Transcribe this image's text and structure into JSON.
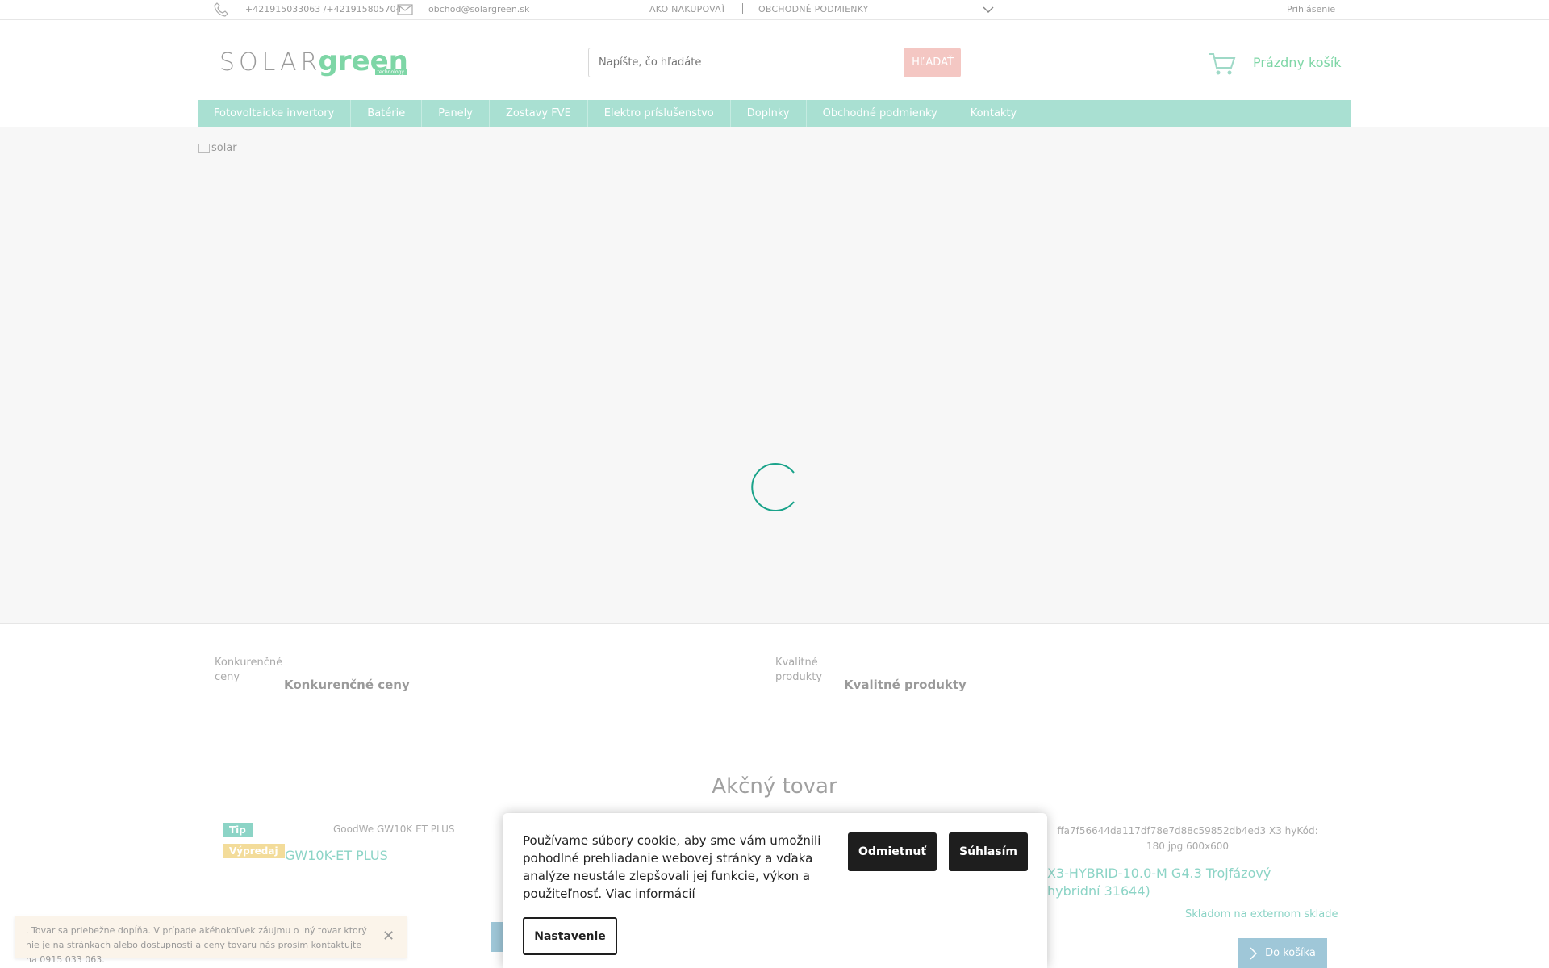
{
  "topbar": {
    "phone": "+421915033063 /+421915805704",
    "email": "obchod@solargreen.sk",
    "link_how_to_buy": "AKO NAKUPOVAŤ",
    "link_terms": "OBCHODNÉ PODMIENKY",
    "login": "Prihlásenie"
  },
  "header": {
    "logo_solar": "SOLAR",
    "logo_green": "green",
    "logo_sub": "technology",
    "search_placeholder": "Napíšte, čo hľadáte",
    "search_button": "HĽADAŤ",
    "cart_label": "Prázdny košík"
  },
  "nav": {
    "items": [
      {
        "label": "Fotovoltaicke invertory"
      },
      {
        "label": "Batérie"
      },
      {
        "label": "Panely"
      },
      {
        "label": "Zostavy FVE"
      },
      {
        "label": "Elektro príslušenstvo"
      },
      {
        "label": "Doplnky"
      },
      {
        "label": "Obchodné podmienky"
      },
      {
        "label": "Kontakty"
      }
    ]
  },
  "banner": {
    "image_alt": "solar"
  },
  "benefits": [
    {
      "image_alt": "Konkurenčné ceny",
      "label": "Konkurenčné ceny"
    },
    {
      "image_alt": "Kvalitné produkty",
      "label": "Kvalitné produkty"
    }
  ],
  "section_title": "Akčný tovar",
  "products": [
    {
      "badge_tip": "Tip",
      "badge_sale": "Výpredaj",
      "image_alt": "GoodWe GW10K ET PLUS",
      "name": "GW10K-ET PLUS"
    },
    {
      "image_alt": "ffa7f56644da117df78e7d88c59852db4ed3 X3 hyKód: 180 jpg 600x600",
      "name": "X3-HYBRID-10.0-M G4.3 Trojfázový hybridní 31644)",
      "stock": "Skladom na externom sklade",
      "cart_button": "Do košíka"
    }
  ],
  "notice": {
    "text": ". Tovar sa priebežne dopĺňa. V prípade akéhokoľvek záujmu o iný tovar ktorý nie je na stránkach alebo dostupnosti a ceny tovaru nás prosím kontaktujte na 0915 033 063."
  },
  "cookie": {
    "text": "Používame súbory cookie, aby sme vám umožnili pohodlné prehliadanie webovej stránky a vďaka analýze neustále zlepšovali jej funkcie, výkon a použiteľnosť.",
    "link": "Viac informácií",
    "reject": "Odmietnuť",
    "accept": "Súhlasím",
    "settings": "Nastavenie"
  },
  "colors": {
    "accent": "#a9e0d2",
    "brand_green": "#7ed6a6",
    "search_button": "#f4c7c3",
    "spinner": "#1aa38a"
  }
}
